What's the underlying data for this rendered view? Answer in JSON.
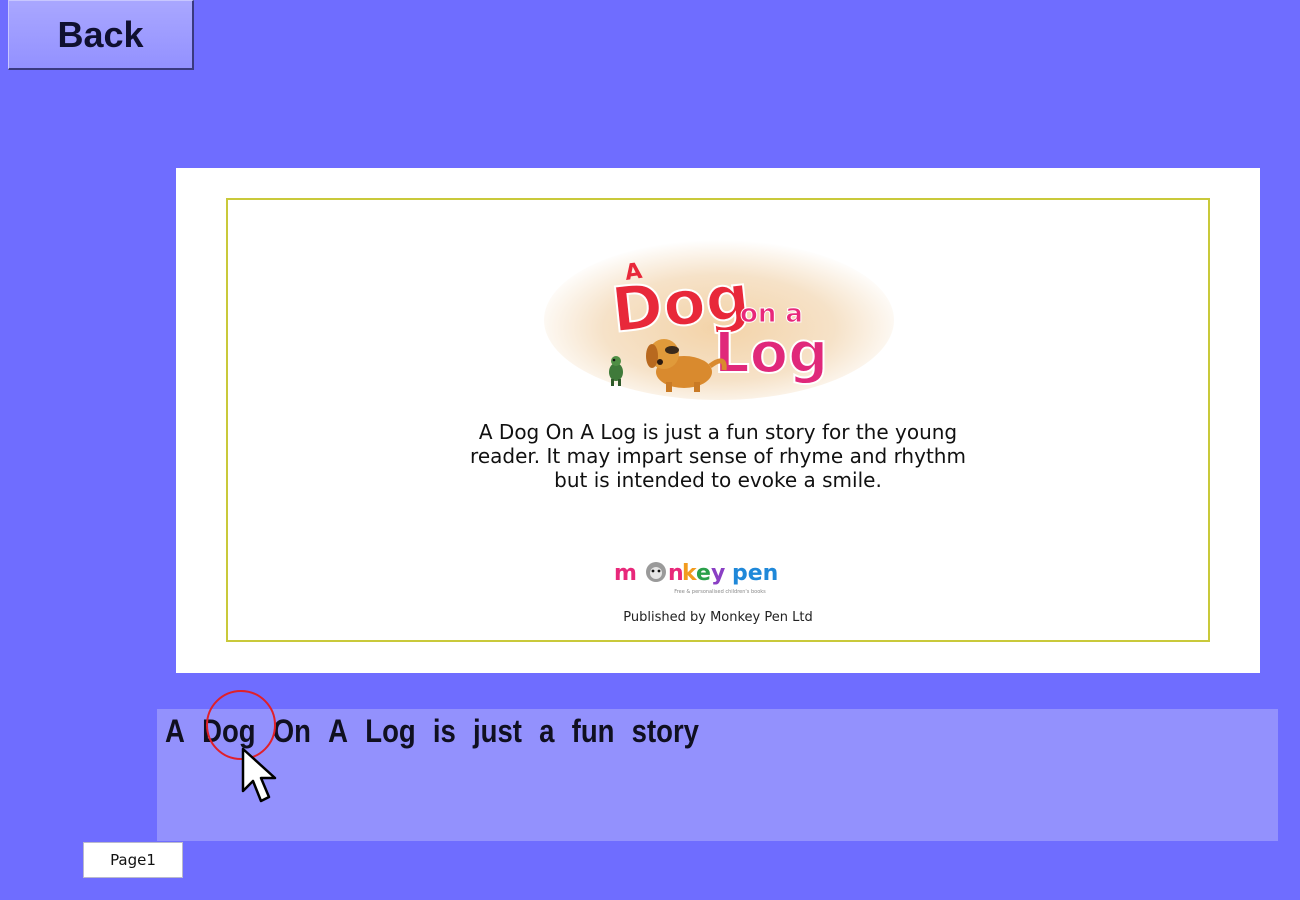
{
  "toolbar": {
    "back_label": "Back"
  },
  "book_page": {
    "cover_title_logo": "A Dog on a Log",
    "blurb_lines": [
      "A Dog On A Log is just a fun story for the young",
      "reader. It may impart sense of rhyme and rhythm",
      "but is intended to evoke a smile."
    ],
    "publisher_logo_text": "monkey pen",
    "publisher_tagline": "Free & personalised children's books",
    "publisher_line": "Published by Monkey Pen Ltd",
    "frame_color": "#c9c93a"
  },
  "reading_panel": {
    "words": [
      "A",
      "Dog",
      "On",
      "A",
      "Log",
      "is",
      "just",
      "a",
      "fun",
      "story"
    ],
    "highlighted_word_index": 1,
    "highlight_color": "#e0202a"
  },
  "page_indicator": {
    "label": "Page1"
  },
  "colors": {
    "background": "#6f6dff",
    "text_panel": "#9391fd",
    "button": "#a9a7ff"
  },
  "icons": {
    "cursor": "arrow-pointer-icon"
  }
}
